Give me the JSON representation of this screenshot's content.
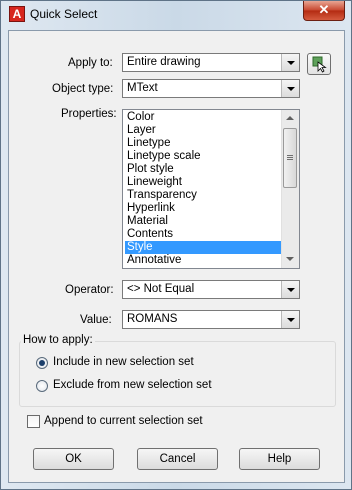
{
  "window": {
    "title": "Quick Select",
    "icon_letter": "A",
    "close_glyph": "✕"
  },
  "fields": {
    "apply_to": {
      "label": "Apply to:",
      "value": "Entire drawing"
    },
    "object_type": {
      "label": "Object type:",
      "value": "MText"
    },
    "properties": {
      "label": "Properties:",
      "items": [
        "Color",
        "Layer",
        "Linetype",
        "Linetype scale",
        "Plot style",
        "Lineweight",
        "Transparency",
        "Hyperlink",
        "Material",
        "Contents",
        "Style",
        "Annotative"
      ],
      "selected": "Style"
    },
    "operator": {
      "label": "Operator:",
      "value": "<> Not Equal"
    },
    "value": {
      "label": "Value:",
      "value": "ROMANS"
    }
  },
  "how_to_apply": {
    "label": "How to apply:",
    "options": [
      {
        "label": "Include in new selection set",
        "selected": true
      },
      {
        "label": "Exclude from new selection set",
        "selected": false
      }
    ]
  },
  "append": {
    "label": "Append to current selection set",
    "checked": false
  },
  "buttons": {
    "ok": "OK",
    "cancel": "Cancel",
    "help": "Help"
  },
  "icons": {
    "select_objects": "select-objects-icon",
    "close": "close-icon"
  },
  "colors": {
    "selection": "#3399ff",
    "close_button": "#c7452d",
    "title_bar": "#cad9e7"
  }
}
